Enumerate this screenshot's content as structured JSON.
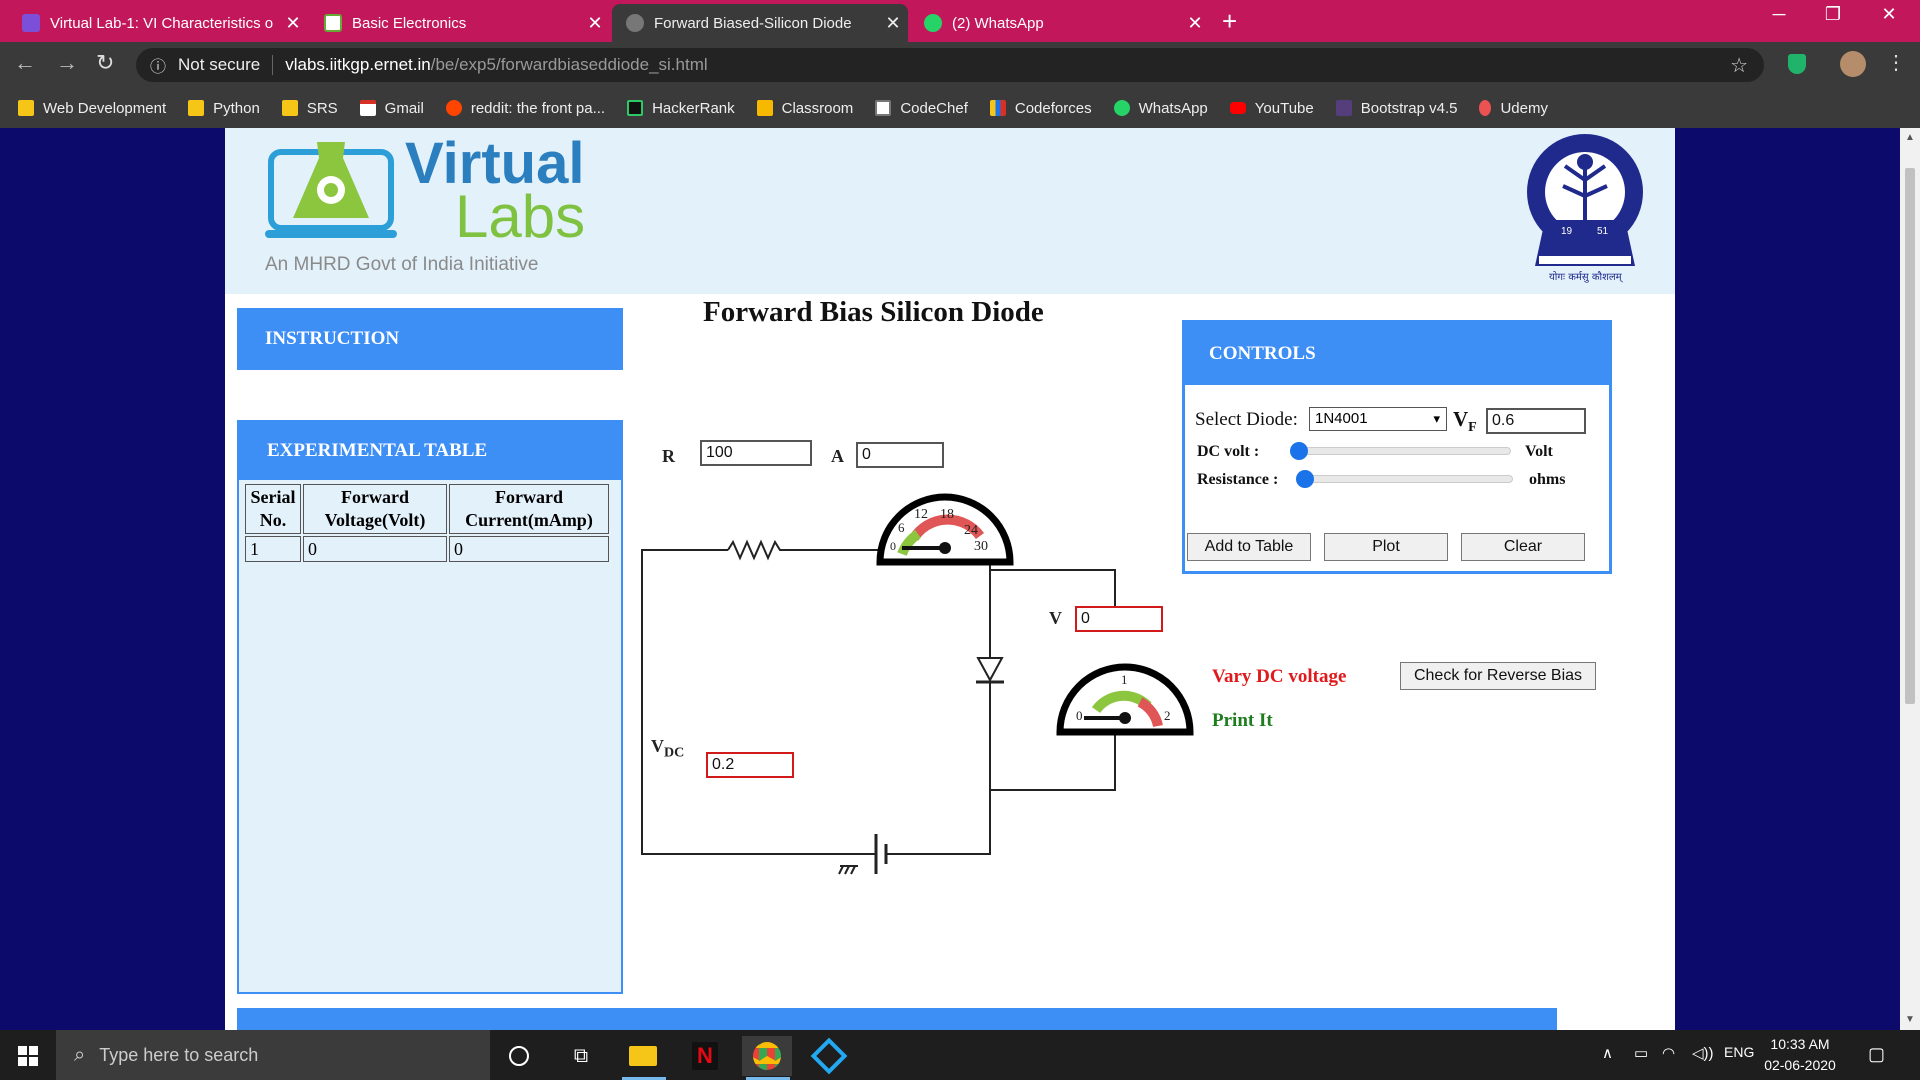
{
  "browser": {
    "tabs": [
      {
        "label": "Virtual Lab-1: VI Characteristics o",
        "active": false
      },
      {
        "label": "Basic Electronics",
        "active": false
      },
      {
        "label": "Forward Biased-Silicon Diode",
        "active": true
      },
      {
        "label": "(2) WhatsApp",
        "active": false
      }
    ],
    "security_label": "Not secure",
    "url_host": "vlabs.iitkgp.ernet.in",
    "url_path": "/be/exp5/forwardbiaseddiode_si.html",
    "bookmarks": [
      "Web Development",
      "Python",
      "SRS",
      "Gmail",
      "reddit: the front pa...",
      "HackerRank",
      "Classroom",
      "CodeChef",
      "Codeforces",
      "WhatsApp",
      "YouTube",
      "Bootstrap v4.5",
      "Udemy"
    ]
  },
  "header": {
    "logo_line1": "Virtual",
    "logo_line2": "Labs",
    "logo_tagline": "An MHRD Govt of India Initiative",
    "iit_year_left": "19",
    "iit_year_right": "51",
    "iit_motto": "योगः कर्मसु कौशलम्"
  },
  "page": {
    "title": "Forward Bias Silicon Diode",
    "instruction_heading": "INSTRUCTION",
    "experimental_heading": "EXPERIMENTAL TABLE",
    "table": {
      "headers": [
        [
          "Serial",
          "No."
        ],
        [
          "Forward",
          "Voltage(Volt)"
        ],
        [
          "Forward",
          "Current(mAmp)"
        ]
      ],
      "rows": [
        [
          "1",
          "0",
          "0"
        ]
      ]
    }
  },
  "circuit": {
    "r_label": "R",
    "r_value": "100",
    "a_label": "A",
    "a_value": "0",
    "v_label": "V",
    "v_value": "0",
    "vdc_label": "V",
    "vdc_sub": "DC",
    "vdc_value": "0.2",
    "ammeter_ticks": [
      "0",
      "6",
      "12",
      "18",
      "24",
      "30"
    ],
    "voltmeter_ticks": [
      "0",
      "1",
      "2"
    ]
  },
  "controls": {
    "heading": "CONTROLS",
    "select_diode_label": "Select Diode:",
    "diode_selected": "1N4001",
    "vf_label": "V",
    "vf_sub": "F",
    "vf_value": "0.6",
    "dc_volt_label": "DC volt :",
    "dc_volt_unit": "Volt",
    "resistance_label": "Resistance :",
    "resistance_unit": "ohms",
    "dc_volt_level": 0,
    "resistance_level": 0,
    "add_to_table": "Add to Table",
    "plot": "Plot",
    "clear": "Clear",
    "vary_dc": "Vary DC voltage",
    "check_reverse": "Check for Reverse Bias",
    "print_it": "Print It"
  },
  "taskbar": {
    "search_placeholder": "Type here to search",
    "time": "10:33 AM",
    "date": "02-06-2020",
    "lang": "ENG"
  },
  "colors": {
    "tab_bar": "#c2185b",
    "panel_blue": "#3d8ef5",
    "page_bg": "#0c0a6b",
    "header_bg": "#e3f1fb",
    "vary_red": "#e0191c",
    "print_green": "#1e7d1e"
  }
}
